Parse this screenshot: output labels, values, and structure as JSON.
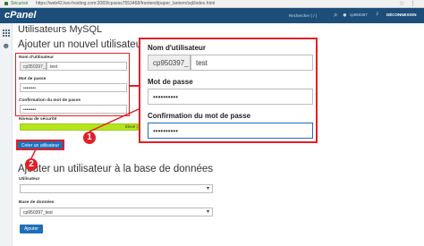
{
  "browser": {
    "secure_label": "Sécurisé",
    "url": "https://web42.lwo-hosting.com:2083/cpsess7553468/frontend/paper_lantern/sql/index.html"
  },
  "header": {
    "logo": "cPanel",
    "search_placeholder": "Rechercher ( / )",
    "username": "cp950397",
    "logout": "DÉCONNEXION"
  },
  "page": {
    "title": "Utilisateurs MySQL"
  },
  "add_user": {
    "heading": "Ajouter un nouvel utilisateur",
    "username_label": "Nom d'utilisateur",
    "prefix": "cp950397_",
    "username_value": "test",
    "password_label": "Mot de passe",
    "password_value": "••••••••",
    "password_confirm_label": "Confirmation du mot de passe",
    "password_confirm_value": "••••••••",
    "strength_label": "Niveau de sécurité",
    "strength_text": "Élevé (100/100)",
    "create_button": "Créer un utilisateur"
  },
  "zoom": {
    "username_label": "Nom d'utilisateur",
    "prefix": "cp950397_",
    "username_value": "test",
    "password_label": "Mot de passe",
    "password_value": "••••••••••",
    "password_confirm_label": "Confirmation du mot de passe",
    "password_confirm_value": "••••••••••"
  },
  "annotations": {
    "step1": "1",
    "step2": "2"
  },
  "add_to_db": {
    "heading": "Ajouter un utilisateur à la base de données",
    "user_label": "Utilisateur",
    "user_value": "",
    "db_label": "Base de données",
    "db_value": "cp950397_test",
    "add_button": "Ajouter"
  },
  "icons": {
    "lock": "lock-icon",
    "search": "search-icon",
    "user": "user-icon",
    "bell": "bell-icon",
    "grid": "grid-icon",
    "users": "users-icon"
  },
  "colors": {
    "header_bg": "#1d4e7a",
    "accent_red": "#e21f26",
    "button_blue": "#1d6fb8",
    "strength_green": "#b5e61d"
  }
}
